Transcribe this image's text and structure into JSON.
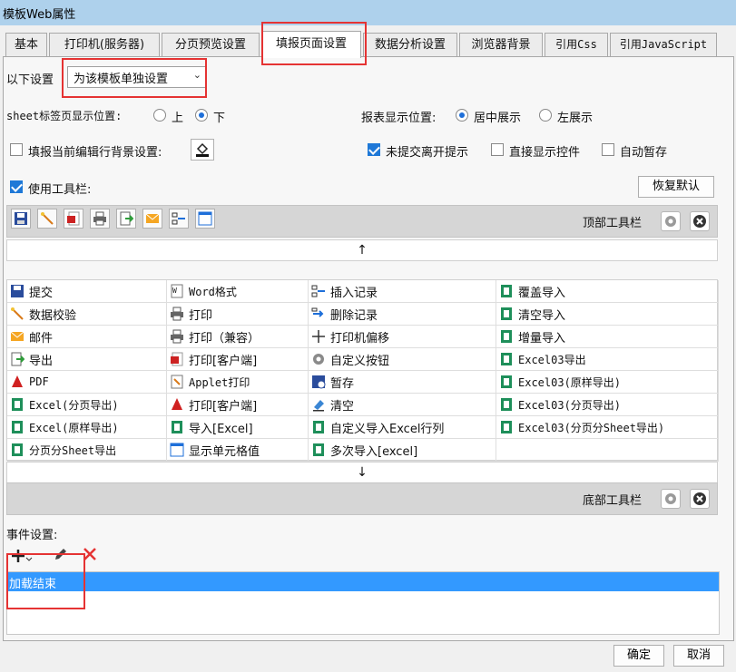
{
  "window": {
    "title": "模板Web属性"
  },
  "tabs": [
    {
      "label": "基本"
    },
    {
      "label": "打印机(服务器)"
    },
    {
      "label": "分页预览设置"
    },
    {
      "label": "填报页面设置"
    },
    {
      "label": "数据分析设置"
    },
    {
      "label": "浏览器背景"
    },
    {
      "label": "引用Css"
    },
    {
      "label": "引用JavaScript"
    }
  ],
  "settings": {
    "scope_label": "以下设置",
    "scope_value": "为该模板单独设置",
    "sheet_pos_label": "sheet标签页显示位置:",
    "sheet_pos_options": [
      "上",
      "下"
    ],
    "report_pos_label": "报表显示位置:",
    "report_pos_options": [
      "居中展示",
      "左展示"
    ],
    "row_bg_label": "填报当前编辑行背景设置:",
    "unsubmitted_label": "未提交离开提示",
    "show_widgets_label": "直接显示控件",
    "auto_save_label": "自动暂存",
    "use_toolbar_label": "使用工具栏:",
    "restore_default": "恢复默认"
  },
  "toolbars": {
    "top_label": "顶部工具栏",
    "bottom_label": "底部工具栏",
    "up_arrow": "↑",
    "down_arrow": "↓"
  },
  "items": {
    "c1": [
      "提交",
      "数据校验",
      "邮件",
      "导出",
      "PDF",
      "Excel(分页导出)",
      "Excel(原样导出)",
      "分页分Sheet导出"
    ],
    "c2": [
      "Word格式",
      "打印",
      "打印（兼容）",
      "打印[客户端]",
      "Applet打印",
      "打印[客户端]",
      "导入[Excel]",
      "显示单元格值"
    ],
    "c3": [
      "插入记录",
      "删除记录",
      "打印机偏移",
      "自定义按钮",
      "暂存",
      "清空",
      "自定义导入Excel行列",
      "多次导入[excel]"
    ],
    "c4": [
      "覆盖导入",
      "清空导入",
      "增量导入",
      "Excel03导出",
      "Excel03(原样导出)",
      "Excel03(分页导出)",
      "Excel03(分页分Sheet导出)"
    ]
  },
  "events": {
    "label": "事件设置:",
    "list": [
      "加载结束"
    ]
  },
  "footer": {
    "ok": "确定",
    "cancel": "取消"
  },
  "colors": {
    "accent": "#3399ff",
    "titlebar": "#aed1ec",
    "highlight": "#e53333"
  }
}
